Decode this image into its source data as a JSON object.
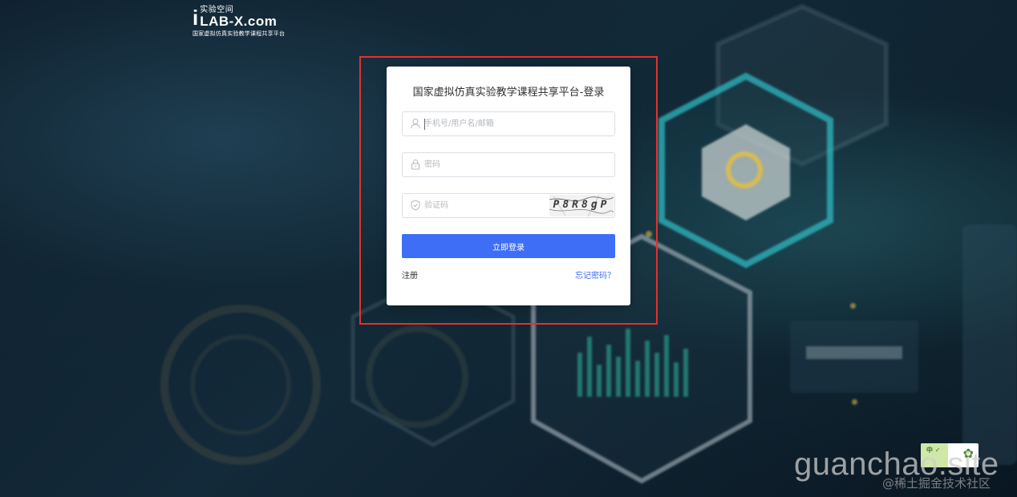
{
  "logo": {
    "letter": "i",
    "name_cn": "实验空间",
    "name_en": "LAB-X.com",
    "subtitle": "国家虚拟仿真实验教学课程共享平台"
  },
  "login": {
    "title": "国家虚拟仿真实验教学课程共享平台-登录",
    "username_placeholder": "手机号/用户名/邮箱",
    "password_placeholder": "密码",
    "captcha_placeholder": "验证码",
    "captcha_text": "P8R8gP",
    "submit_label": "立即登录",
    "register_label": "注册",
    "forgot_label": "忘记密码？"
  },
  "badge": {
    "text": "中 ✓"
  },
  "watermarks": {
    "site": "guanchao.site",
    "community": "@稀土掘金技术社区"
  },
  "colors": {
    "primary": "#3e6ef6",
    "highlight_frame": "#e3312d",
    "background": "#0f2230",
    "hex_glow": "#2fb8c0"
  },
  "icons": {
    "username": "user-icon",
    "password": "lock-icon",
    "captcha": "shield-icon"
  }
}
